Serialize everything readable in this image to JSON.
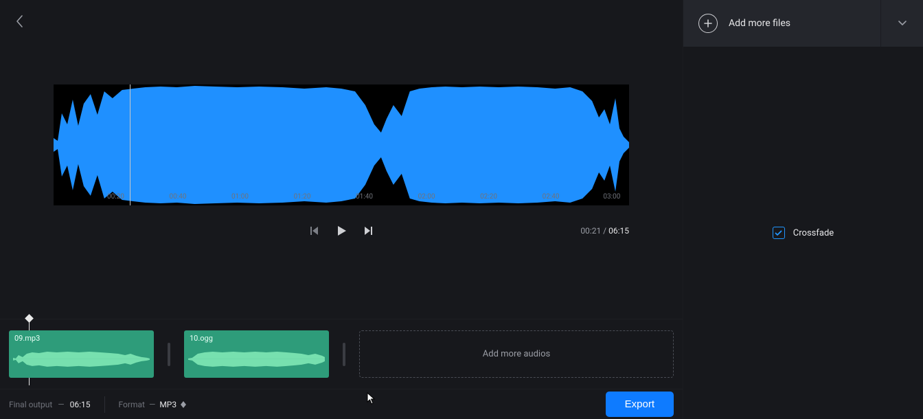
{
  "colors": {
    "wave": "#1f90ff",
    "clip": "#2e9c7a",
    "export": "#0e7bff",
    "accent": "#2196ff"
  },
  "preview": {
    "tick_labels": [
      "00:20",
      "00:40",
      "01:00",
      "01:20",
      "01:40",
      "02:00",
      "02:20",
      "02:40",
      "03:00"
    ]
  },
  "transport": {
    "current": "00:21",
    "total": "06:15",
    "separator": " / "
  },
  "timeline": {
    "clips": [
      {
        "name": "09.mp3"
      },
      {
        "name": "10.ogg"
      }
    ],
    "drop_label": "Add more audios"
  },
  "bottom": {
    "final_output_label": "Final output",
    "final_output_value": "06:15",
    "format_label": "Format",
    "format_value": "MP3",
    "export_label": "Export"
  },
  "side": {
    "add_label": "Add more files",
    "crossfade_label": "Crossfade",
    "crossfade_checked": true
  }
}
